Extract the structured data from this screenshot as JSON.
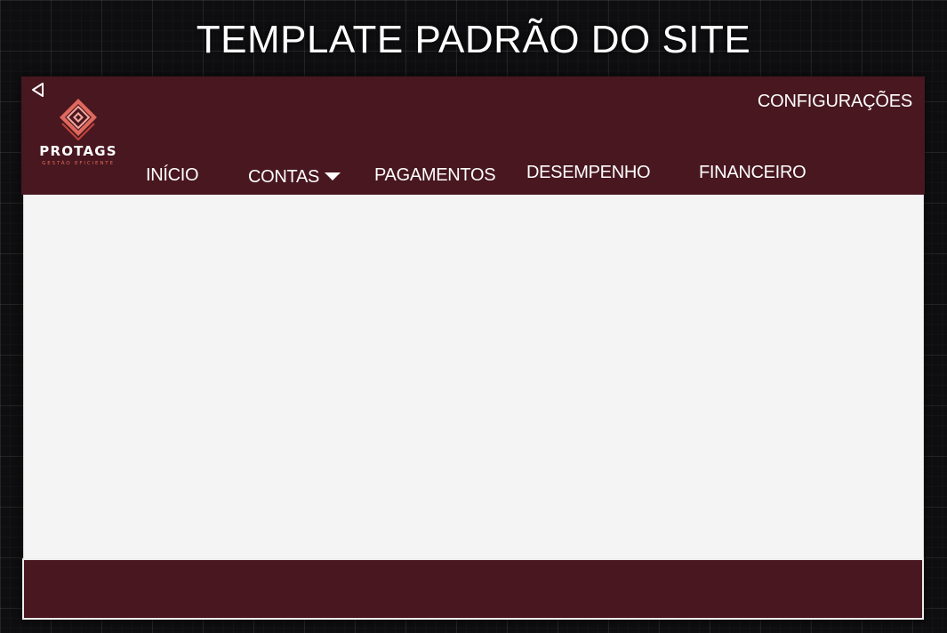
{
  "page_title": "TEMPLATE PADRÃO DO SITE",
  "header": {
    "back_icon": "back-triangle-icon",
    "settings_label": "CONFIGURAÇÕES",
    "logo": {
      "name": "PROTAGS",
      "tagline": "GESTÃO EFICIENTE",
      "icon": "diamond-logo-icon"
    },
    "nav": {
      "inicio": "INÍCIO",
      "contas": "CONTAS",
      "pagamentos": "PAGAMENTOS",
      "desempenho": "DESEMPENHO",
      "financeiro": "FINANCEIRO"
    }
  },
  "colors": {
    "header_bg": "#48171f",
    "content_bg": "#f4f4f4",
    "logo_accent": "#e0685d",
    "page_bg": "#0e0e10"
  }
}
